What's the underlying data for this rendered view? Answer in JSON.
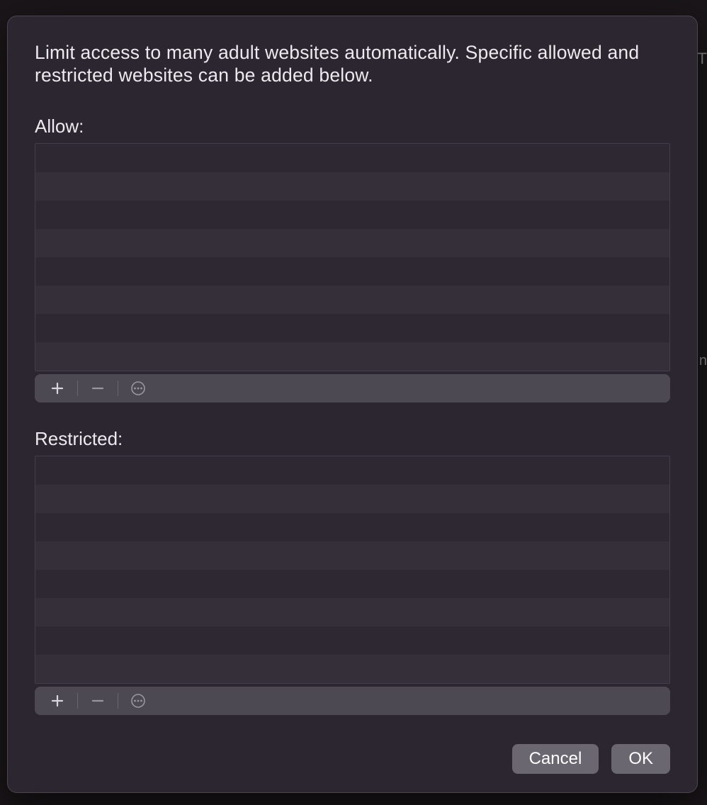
{
  "dialog": {
    "description": "Limit access to many adult websites automatically. Specific allowed and restricted websites can be added below.",
    "allow": {
      "label": "Allow:",
      "rows": [
        "",
        "",
        "",
        "",
        "",
        "",
        "",
        ""
      ],
      "add_enabled": true,
      "remove_enabled": false,
      "more_enabled": false
    },
    "restricted": {
      "label": "Restricted:",
      "rows": [
        "",
        "",
        "",
        "",
        "",
        "",
        "",
        ""
      ],
      "add_enabled": true,
      "remove_enabled": false,
      "more_enabled": false
    },
    "buttons": {
      "cancel": "Cancel",
      "ok": "OK"
    }
  }
}
